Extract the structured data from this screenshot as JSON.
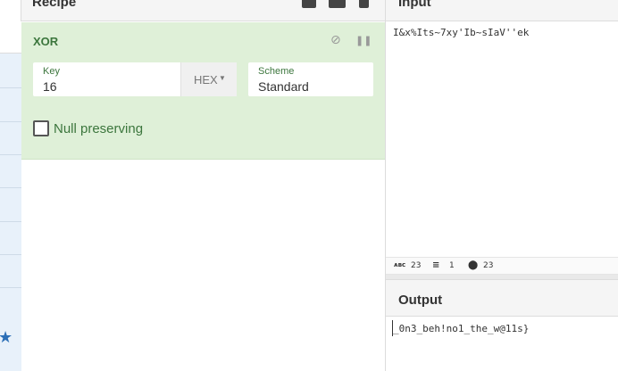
{
  "recipe": {
    "title": "Recipe",
    "operation": {
      "name": "XOR",
      "key_label": "Key",
      "key_value": "16",
      "key_format": "HEX",
      "scheme_label": "Scheme",
      "scheme_value": "Standard",
      "null_preserving_label": "Null preserving",
      "null_preserving_checked": false
    }
  },
  "input": {
    "title": "Input",
    "text": "I&x%Its~7xy'Ib~sIaV''ek"
  },
  "status": {
    "length": "23",
    "lines": "1",
    "position": "23"
  },
  "output": {
    "title": "Output",
    "text": "_0n3_beh!no1_the_w@11s}"
  },
  "colors": {
    "operation_bg": "#dff0d8",
    "operation_text": "#3c763d",
    "sidebar_list": "#e8f1fa",
    "star": "#2c6fb7"
  },
  "icons": [
    "save-icon",
    "folder-icon",
    "trash-icon",
    "disable-icon",
    "pause-icon",
    "star-icon",
    "length-icon",
    "lines-icon",
    "position-icon",
    "chevron-down-icon"
  ]
}
